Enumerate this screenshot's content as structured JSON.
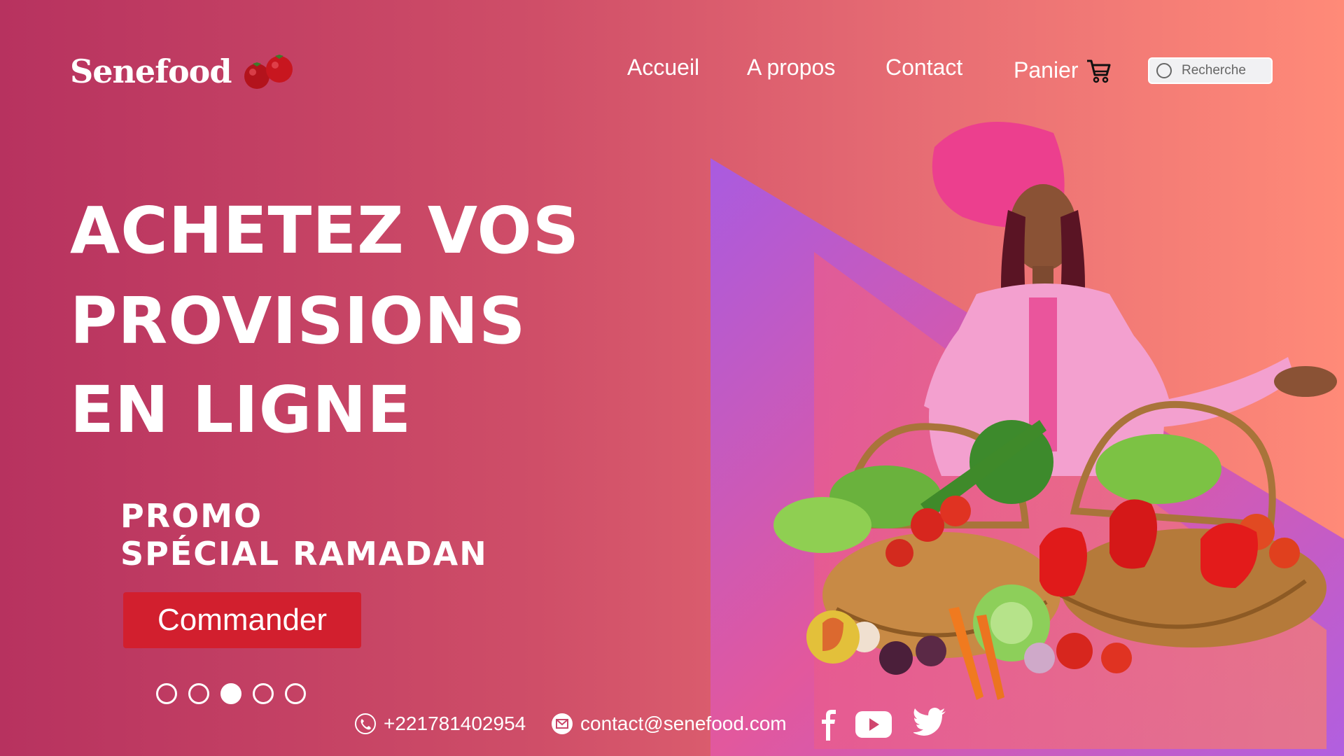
{
  "brand": {
    "name": "Senefood",
    "icon": "tomato-icon"
  },
  "nav": {
    "items": [
      {
        "label": "Accueil"
      },
      {
        "label": "A propos"
      },
      {
        "label": "Contact"
      },
      {
        "label": "Panier",
        "icon": "cart-icon"
      }
    ]
  },
  "search": {
    "placeholder": "Recherche",
    "value": ""
  },
  "hero": {
    "lines": [
      "ACHETEZ VOS",
      "PROVISIONS",
      "EN LIGNE"
    ],
    "promo_lines": [
      "PROMO",
      "SPÉCIAL RAMADAN"
    ],
    "cta_label": "Commander"
  },
  "carousel": {
    "count": 5,
    "active_index": 3
  },
  "footer": {
    "phone": "+221781402954",
    "email": "contact@senefood.com",
    "socials": [
      "facebook-icon",
      "youtube-icon",
      "twitter-icon"
    ]
  },
  "colors": {
    "background_start": "#b7325f",
    "background_end": "#ff8a78",
    "button": "#d21f2e",
    "triangle": "#b464dc",
    "text": "#ffffff"
  }
}
